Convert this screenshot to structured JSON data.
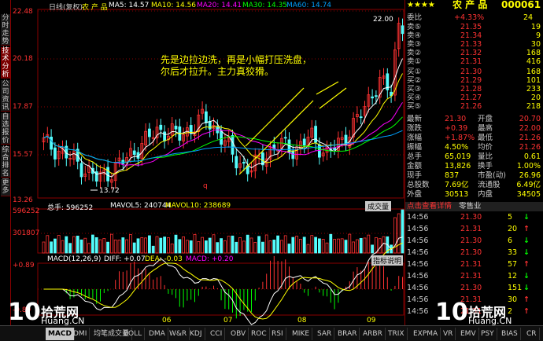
{
  "left_tabs": [
    "分时走势",
    "技术分析",
    "公司资讯",
    "自选报价",
    "综合排名",
    "更多"
  ],
  "header": {
    "period": "日线(复权)",
    "name": "农 产 品",
    "ma5": "MA5: 14.57",
    "ma10": "MA10: 14.56",
    "ma20": "MA20: 14.41",
    "ma30": "MA30: 14.35",
    "ma60": "MA60: 14.74"
  },
  "price_axis": [
    "22.48",
    "20.18",
    "17.87",
    "15.57",
    "13.26"
  ],
  "annotation": {
    "line1": "先是边拉边洗，再是小幅打压洗盘，",
    "line2": "尔后才拉升。主力真狡猾。"
  },
  "high_label": "22.00",
  "low_label": "13.72",
  "marker": "q",
  "volume": {
    "label": "总手: 596252",
    "mavol5": "MAVOL5: 240744",
    "mavol10": "MAVOL10: 238689",
    "axis_top": "596252",
    "axis_mid": "301807",
    "switch": "成交量"
  },
  "macd": {
    "label": "MACD(12,26,9)",
    "diff": "DIFF: +0.07",
    "dea": "DEA: -0.03",
    "macd": "MACD: +0.20",
    "axis_top": "+0.89",
    "axis_bot": "-0.89",
    "help": "指标说明"
  },
  "months": [
    "06",
    "07",
    "08",
    "09"
  ],
  "stock": {
    "stars": "★★★★",
    "name": "农 产 品",
    "code": "000061"
  },
  "order_book": {
    "weibi": {
      "label": "委比",
      "value": "+4.33%",
      "extra": "24"
    },
    "asks": [
      {
        "label": "卖⑤",
        "price": "21.35",
        "vol": "19"
      },
      {
        "label": "卖④",
        "price": "21.34",
        "vol": "9"
      },
      {
        "label": "卖③",
        "price": "21.33",
        "vol": "30"
      },
      {
        "label": "卖②",
        "price": "21.32",
        "vol": "168"
      },
      {
        "label": "卖①",
        "price": "21.31",
        "vol": "416"
      }
    ],
    "bids": [
      {
        "label": "买①",
        "price": "21.30",
        "vol": "168"
      },
      {
        "label": "买②",
        "price": "21.29",
        "vol": "101"
      },
      {
        "label": "买③",
        "price": "21.28",
        "vol": "233"
      },
      {
        "label": "买④",
        "price": "21.27",
        "vol": "20"
      },
      {
        "label": "买⑤",
        "price": "21.26",
        "vol": "218"
      }
    ]
  },
  "quote": [
    {
      "l1": "最新",
      "v1": "21.30",
      "l2": "开盘",
      "v2": "20.70"
    },
    {
      "l1": "涨跌",
      "v1": "+0.39",
      "l2": "最高",
      "v2": "22.00"
    },
    {
      "l1": "涨幅",
      "v1": "+1.87%",
      "l2": "最低",
      "v2": "21.26"
    },
    {
      "l1": "振幅",
      "v1": "4.50%",
      "l2": "均价",
      "v2": "21.26"
    },
    {
      "l1": "总手",
      "v1": "65,019",
      "l2": "量比",
      "v2": "0.61"
    },
    {
      "l1": "金额",
      "v1": "13,826",
      "l2": "换手",
      "v2": "1.00%"
    },
    {
      "l1": "现手",
      "v1": "837",
      "l2": "市盈(动)",
      "v2": "26.96"
    },
    {
      "l1": "总股数",
      "v1": "7.69亿",
      "l2": "流通股",
      "v2": "6.49亿"
    },
    {
      "l1": "外盘",
      "v1": "30513",
      "l2": "内盘",
      "v2": "34505"
    }
  ],
  "detail_tabs": {
    "a": "点击查看详情",
    "b": "零售业"
  },
  "ticks": [
    {
      "time": "14:56",
      "price": "21.30",
      "vol": "5",
      "dir": "down"
    },
    {
      "time": "14:56",
      "price": "21.31",
      "vol": "20",
      "dir": "up"
    },
    {
      "time": "14:56",
      "price": "21.30",
      "vol": "6",
      "dir": "down"
    },
    {
      "time": "14:56",
      "price": "21.30",
      "vol": "33",
      "dir": "down"
    },
    {
      "time": "14:56",
      "price": "21.31",
      "vol": "57",
      "dir": "up"
    },
    {
      "time": "14:56",
      "price": "21.31",
      "vol": "12",
      "dir": "down"
    },
    {
      "time": "14:56",
      "price": "21.30",
      "vol": "151",
      "dir": "down"
    },
    {
      "time": "14:56",
      "price": "21.31",
      "vol": "30",
      "dir": "up"
    },
    {
      "time": "14:56",
      "price": "21.31",
      "vol": "2",
      "dir": "up"
    }
  ],
  "bottom_tabs": [
    "MACD",
    "DMI",
    "均笔成交量",
    "BOLL",
    "DMA",
    "W&R",
    "KDJ",
    "CCI",
    "OBV",
    "ROC",
    "RSI",
    "MIKE",
    "SAR",
    "BRAR",
    "ARBR",
    "TRIX",
    "EXPMA",
    "VR",
    "EMV",
    "PSY",
    "BIAS",
    "CR",
    "VET"
  ],
  "watermark": {
    "brand": "拾荒网",
    "url": "Huang.CN",
    "num": "10"
  },
  "colors": {
    "up": "#ff3232",
    "down": "#54fcfc",
    "ma5": "#ffffff",
    "ma10": "#ffff00",
    "ma20": "#ff00ff",
    "ma30": "#00ff00",
    "ma60": "#00a0ff"
  }
}
